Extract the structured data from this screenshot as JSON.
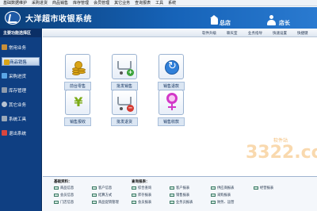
{
  "menu": [
    "基础数据维护",
    "采购进货",
    "商品销售",
    "库存管理",
    "会员管理",
    "其它业务",
    "查询报表",
    "工具",
    "系统"
  ],
  "header": {
    "title": "大洋超市收银系统",
    "shop": "总店",
    "user": "店长"
  },
  "sidebar": {
    "title": "主要功能选择区",
    "items": [
      {
        "label": "常用业务",
        "icon": "folder-icon",
        "color": "#c98f3a"
      },
      {
        "label": "商品销售",
        "icon": "coins-icon",
        "color": "#d9a417"
      },
      {
        "label": "采购进货",
        "icon": "truck-icon",
        "color": "#5aa5e6"
      },
      {
        "label": "库存管理",
        "icon": "warehouse-icon",
        "color": "#8e9bad"
      },
      {
        "label": "其它业务",
        "icon": "gear-icon",
        "color": "#b7c3d2"
      },
      {
        "label": "系统工具",
        "icon": "tools-icon",
        "color": "#9aa8b8"
      },
      {
        "label": "退出系统",
        "icon": "exit-icon",
        "color": "#d9463e"
      }
    ]
  },
  "toolbar": [
    "软件升级",
    "聊天室",
    "业务指导",
    "快速设置",
    "快捷键"
  ],
  "tiles": [
    {
      "label": "前台零售",
      "icon": "coins-icon"
    },
    {
      "label": "批发销售",
      "icon": "cart-add-icon"
    },
    {
      "label": "销售退款",
      "icon": "refresh-icon"
    },
    {
      "label": "销售报收",
      "icon": "yen-icon"
    },
    {
      "label": "批发退货",
      "icon": "cart-remove-icon"
    },
    {
      "label": "销售收款",
      "icon": "female-icon"
    }
  ],
  "bottom": {
    "basic_title": "基础资料：",
    "query_title": "查询报表：",
    "basic_links": [
      "商品信息",
      "客户信息",
      "会员信息",
      "结算方式",
      "门店信息",
      "商品促销管理"
    ],
    "query_links": [
      "综合查询",
      "客户报表",
      "供应商报表",
      "经营报表",
      "库存报表",
      "销售报表",
      "采购报表",
      "会员报表",
      "业务员报表",
      "财务、运营"
    ]
  },
  "watermark": {
    "logo": "3322.cc",
    "tag": "软件站"
  }
}
